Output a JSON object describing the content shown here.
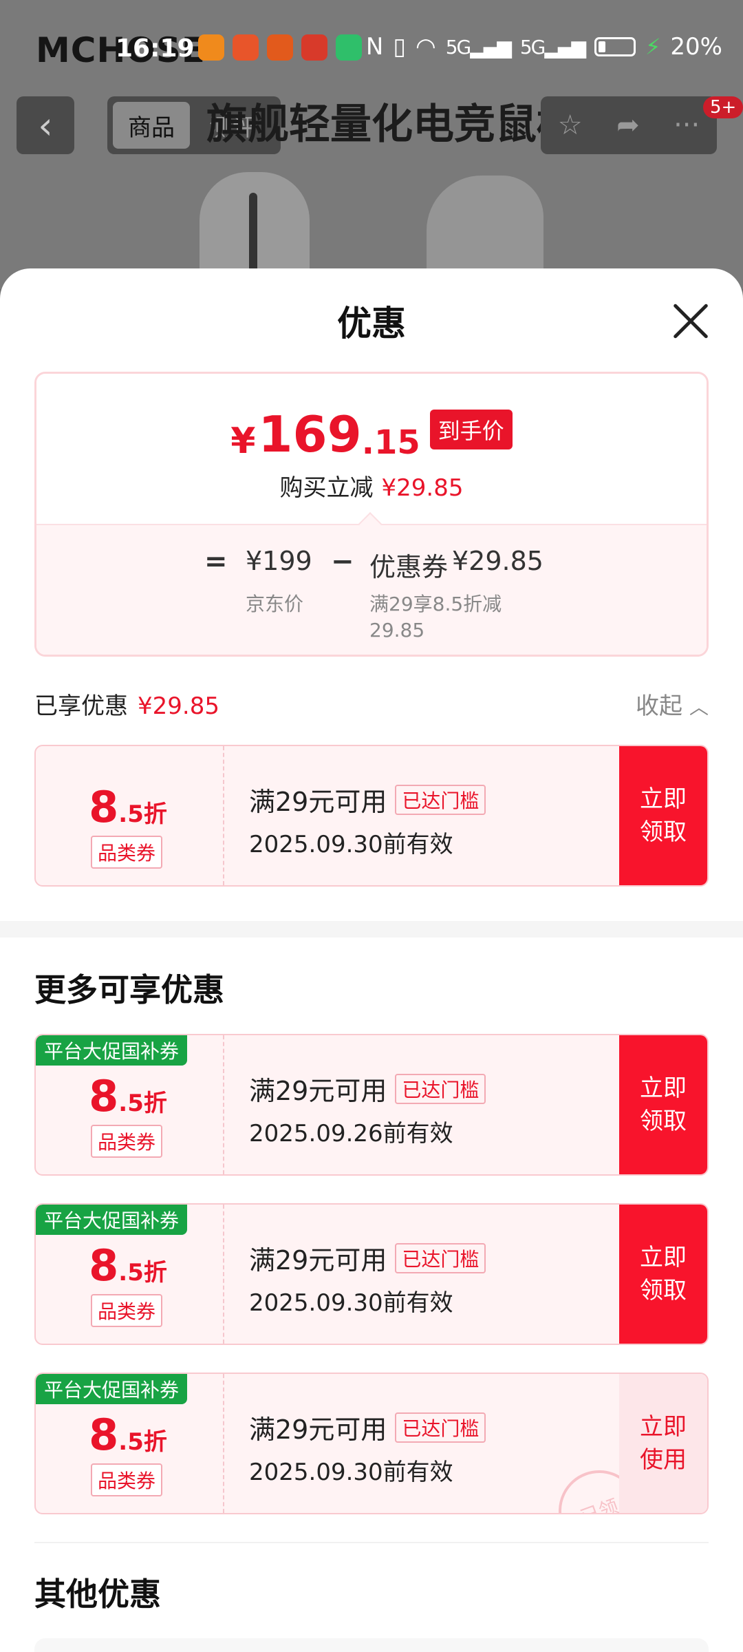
{
  "status": {
    "time": "16:19",
    "battery": "20%",
    "signal1": "5G",
    "signal2": "5G"
  },
  "background": {
    "brand": "MCHOSE",
    "title": "旗舰轻量化电竞鼠标",
    "tab_product": "商品",
    "tab_review": "测评",
    "badge": "5+"
  },
  "sheet": {
    "title": "优惠",
    "price": {
      "currency": "¥",
      "integer": "169",
      "decimal": ".15",
      "tag": "到手价",
      "sub_label": "购买立减",
      "sub_amount": "¥29.85",
      "equals": "=",
      "jd_price": "¥199",
      "jd_label": "京东价",
      "minus": "−",
      "coupon_label": "优惠券",
      "coupon_amount": "¥29.85",
      "coupon_desc_1": "满29享8.5折减",
      "coupon_desc_2": "29.85"
    },
    "enjoyed": {
      "label": "已享优惠",
      "amount": "¥29.85",
      "collapse": "收起"
    },
    "more_title": "更多可享优惠",
    "other_title": "其他优惠",
    "coupons": [
      {
        "discount_big": "8",
        "discount_small": ".5折",
        "type": "品类券",
        "condition": "满29元可用",
        "threshold": "已达门槛",
        "date": "2025.09.30前有效",
        "button": "立即领取",
        "flag": ""
      },
      {
        "discount_big": "8",
        "discount_small": ".5折",
        "type": "品类券",
        "condition": "满29元可用",
        "threshold": "已达门槛",
        "date": "2025.09.26前有效",
        "button": "立即领取",
        "flag": "平台大促国补券"
      },
      {
        "discount_big": "8",
        "discount_small": ".5折",
        "type": "品类券",
        "condition": "满29元可用",
        "threshold": "已达门槛",
        "date": "2025.09.30前有效",
        "button": "立即领取",
        "flag": "平台大促国补券"
      },
      {
        "discount_big": "8",
        "discount_small": ".5折",
        "type": "品类券",
        "condition": "满29元可用",
        "threshold": "已达门槛",
        "date": "2025.09.30前有效",
        "button": "立即使用",
        "flag": "平台大促国补券",
        "stamp": "已领"
      }
    ]
  },
  "colors": {
    "accent_red": "#e9142a",
    "button_red": "#f8142c",
    "flag_green": "#18a344"
  }
}
